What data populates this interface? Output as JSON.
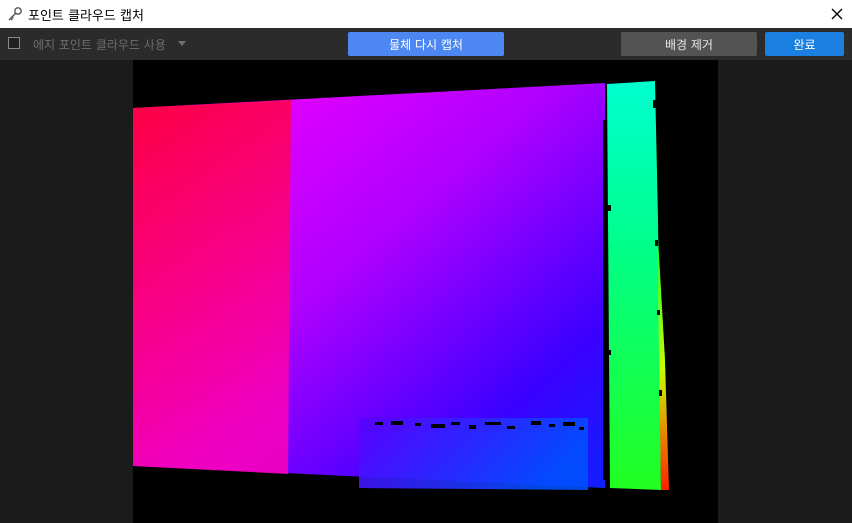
{
  "window": {
    "title": "포인트 클라우드 캡처",
    "icon": "key-icon",
    "close_icon": "close-icon"
  },
  "toolbar": {
    "edge_checkbox_checked": false,
    "edge_label": "에지 포인트 클라우드 사용",
    "edge_dropdown_icon": "caret-down-icon",
    "recapture_label": "물체 다시 캡처",
    "remove_background_label": "배경 제거",
    "done_label": "완료"
  },
  "colors": {
    "recapture_button": "#4d88f2",
    "remove_background_button": "#535353",
    "done_button": "#1a7fe0",
    "toolbar_bg": "#2b2b2b",
    "viewport_bg": "#1b1b1b",
    "canvas_bg": "#000000"
  },
  "viewport": {
    "content": "depth-colored point cloud"
  }
}
